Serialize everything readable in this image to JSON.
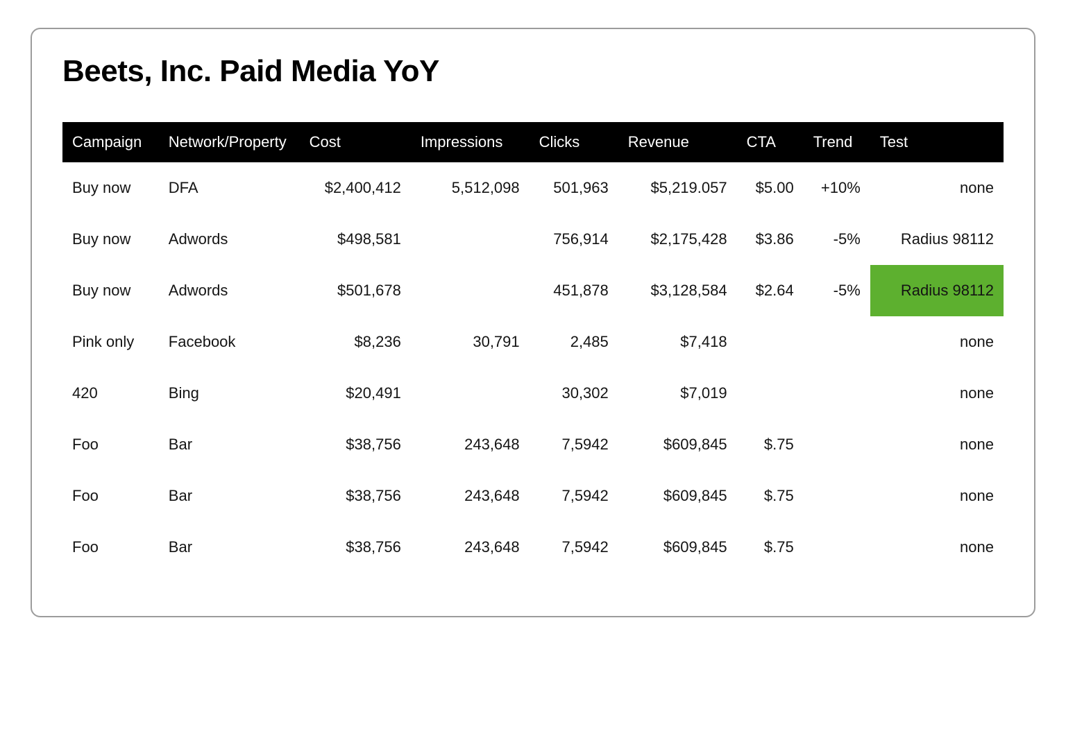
{
  "title": "Beets, Inc. Paid Media YoY",
  "columns": [
    "Campaign",
    "Network/Property",
    "Cost",
    "Impressions",
    "Clicks",
    "Revenue",
    "CTA",
    "Trend",
    "Test"
  ],
  "highlight_color": "#5db02f",
  "chart_data": {
    "type": "table",
    "title": "Beets, Inc. Paid Media YoY",
    "columns": [
      "Campaign",
      "Network/Property",
      "Cost",
      "Impressions",
      "Clicks",
      "Revenue",
      "CTA",
      "Trend",
      "Test"
    ],
    "rows": [
      {
        "campaign": "Buy now",
        "network": "DFA",
        "cost": "$2,400,412",
        "impressions": "5,512,098",
        "clicks": "501,963",
        "revenue": "$5,219.057",
        "cta": "$5.00",
        "trend": "+10%",
        "test": "none",
        "highlight": false
      },
      {
        "campaign": "Buy now",
        "network": "Adwords",
        "cost": "$498,581",
        "impressions": "",
        "clicks": "756,914",
        "revenue": "$2,175,428",
        "cta": "$3.86",
        "trend": "-5%",
        "test": "Radius 98112",
        "highlight": false
      },
      {
        "campaign": "Buy now",
        "network": "Adwords",
        "cost": "$501,678",
        "impressions": "",
        "clicks": "451,878",
        "revenue": "$3,128,584",
        "cta": "$2.64",
        "trend": "-5%",
        "test": "Radius 98112",
        "highlight": true
      },
      {
        "campaign": "Pink only",
        "network": "Facebook",
        "cost": "$8,236",
        "impressions": "30,791",
        "clicks": "2,485",
        "revenue": "$7,418",
        "cta": "",
        "trend": "",
        "test": "none",
        "highlight": false
      },
      {
        "campaign": "420",
        "network": "Bing",
        "cost": "$20,491",
        "impressions": "",
        "clicks": "30,302",
        "revenue": "$7,019",
        "cta": "",
        "trend": "",
        "test": "none",
        "highlight": false
      },
      {
        "campaign": "Foo",
        "network": "Bar",
        "cost": "$38,756",
        "impressions": "243,648",
        "clicks": "7,5942",
        "revenue": "$609,845",
        "cta": "$.75",
        "trend": "",
        "test": "none",
        "highlight": false
      },
      {
        "campaign": "Foo",
        "network": "Bar",
        "cost": "$38,756",
        "impressions": "243,648",
        "clicks": "7,5942",
        "revenue": "$609,845",
        "cta": "$.75",
        "trend": "",
        "test": "none",
        "highlight": false
      },
      {
        "campaign": "Foo",
        "network": "Bar",
        "cost": "$38,756",
        "impressions": "243,648",
        "clicks": "7,5942",
        "revenue": "$609,845",
        "cta": "$.75",
        "trend": "",
        "test": "none",
        "highlight": false
      }
    ]
  }
}
